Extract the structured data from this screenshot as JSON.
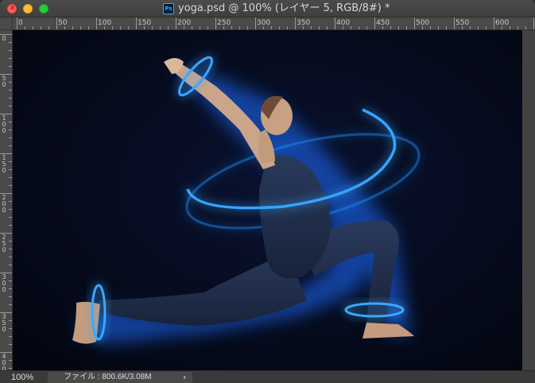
{
  "window": {
    "title": "yoga.psd @ 100% (レイヤー 5, RGB/8#) *",
    "app_icon": "Ps"
  },
  "rulers": {
    "top_labels": [
      "0",
      "50",
      "100",
      "150",
      "200",
      "250",
      "300",
      "350",
      "400",
      "450",
      "500",
      "550",
      "600"
    ],
    "left_labels": [
      "0",
      "50",
      "100",
      "150",
      "200",
      "250",
      "300",
      "350",
      "400"
    ]
  },
  "status": {
    "zoom": "100%",
    "file_info": "ファイル : 800.6K/3.08M",
    "arrow": "›"
  },
  "colors": {
    "canvas_bg": "#050a1a",
    "glow": "#1e90ff",
    "close": "#ff5f57",
    "minimize": "#febc2e",
    "maximize": "#28c840"
  },
  "icons": [
    "close-icon",
    "minimize-icon",
    "maximize-icon",
    "photoshop-file-icon"
  ]
}
